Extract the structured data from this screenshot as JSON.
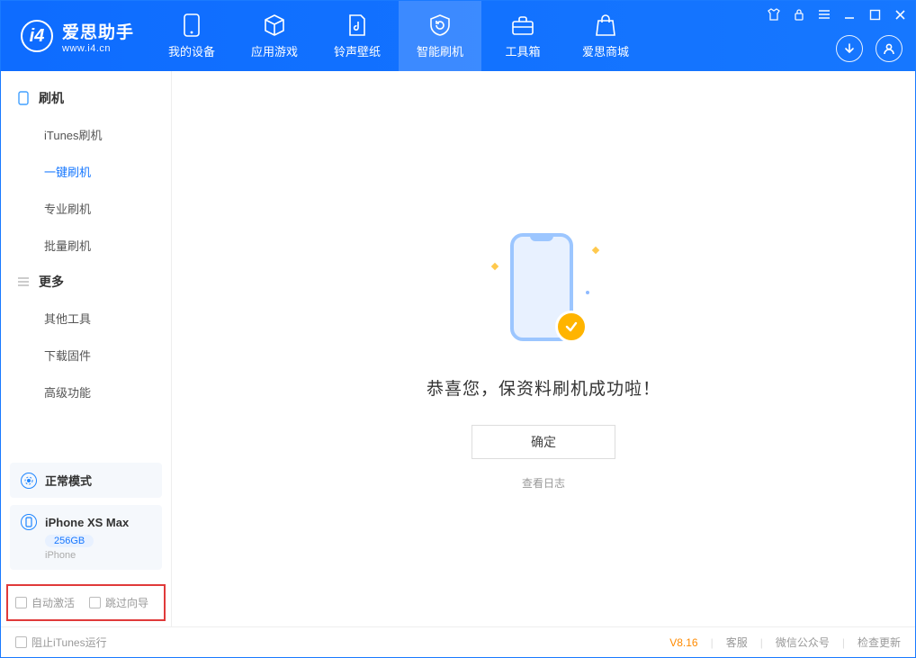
{
  "app": {
    "name": "爱思助手",
    "url": "www.i4.cn"
  },
  "tabs": [
    {
      "label": "我的设备"
    },
    {
      "label": "应用游戏"
    },
    {
      "label": "铃声壁纸"
    },
    {
      "label": "智能刷机"
    },
    {
      "label": "工具箱"
    },
    {
      "label": "爱思商城"
    }
  ],
  "sidebar": {
    "group1": {
      "title": "刷机",
      "items": [
        "iTunes刷机",
        "一键刷机",
        "专业刷机",
        "批量刷机"
      ]
    },
    "group2": {
      "title": "更多",
      "items": [
        "其他工具",
        "下载固件",
        "高级功能"
      ]
    }
  },
  "mode_card": {
    "label": "正常模式"
  },
  "device_card": {
    "name": "iPhone XS Max",
    "storage": "256GB",
    "type": "iPhone"
  },
  "bottom_cb": {
    "auto_activate": "自动激活",
    "skip_guide": "跳过向导"
  },
  "main": {
    "success_text": "恭喜您，保资料刷机成功啦！",
    "ok_btn": "确定",
    "log_link": "查看日志"
  },
  "footer": {
    "block_itunes": "阻止iTunes运行",
    "version": "V8.16",
    "links": [
      "客服",
      "微信公众号",
      "检查更新"
    ]
  }
}
